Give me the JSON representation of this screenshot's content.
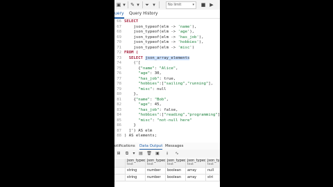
{
  "toolbar": {
    "limit": "No limit"
  },
  "tabs": [
    "uery",
    "Query History"
  ],
  "editor": {
    "lines": [
      {
        "n": "66",
        "c": "SELECT",
        "kind": "kw"
      },
      {
        "n": "67",
        "c": "    json_typeof(elm -> 'name'),"
      },
      {
        "n": "68",
        "c": "    json_typeof(elm -> 'age'),"
      },
      {
        "n": "69",
        "c": "    json_typeof(elm -> 'has_job'),"
      },
      {
        "n": "70",
        "c": "    json_typeof(elm -> 'hobbies'),"
      },
      {
        "n": "71",
        "c": "    json_typeof(elm -> 'misc')"
      },
      {
        "n": "72",
        "c": "FROM (",
        "kind": "kw"
      },
      {
        "n": "73",
        "c": "  SELECT json_array_elements",
        "kind": "kwhl"
      },
      {
        "n": "74",
        "c": "    ('["
      },
      {
        "n": "75",
        "c": "      {\"name\": \"Alice\","
      },
      {
        "n": "76",
        "c": "      \"age\": 30,"
      },
      {
        "n": "77",
        "c": "      \"has_job\": true,"
      },
      {
        "n": "78",
        "c": "      \"hobbies\":[\"sailing\",\"running\"],"
      },
      {
        "n": "79",
        "c": "      \"misc\": null"
      },
      {
        "n": "80",
        "c": "    },"
      },
      {
        "n": "81",
        "c": "    {\"name\": \"Bob\","
      },
      {
        "n": "82",
        "c": "      \"age\": 45,"
      },
      {
        "n": "83",
        "c": "      \"has_job\": false,"
      },
      {
        "n": "84",
        "c": "      \"hobbies\":[\"reading\",\"programming\"],"
      },
      {
        "n": "85",
        "c": "      \"misc\": \"not-null here\""
      },
      {
        "n": "86",
        "c": "    }"
      },
      {
        "n": "87",
        "c": "  ]') AS elm"
      },
      {
        "n": "88",
        "c": ") AS elements;"
      }
    ]
  },
  "results": {
    "tabs": [
      "otifications",
      "Data Output",
      "Messages"
    ],
    "columns": [
      {
        "name": "json_typeof",
        "type": "text"
      },
      {
        "name": "json_typeof",
        "type": "text"
      },
      {
        "name": "json_typeof",
        "type": "text"
      },
      {
        "name": "json_typeof",
        "type": "text"
      },
      {
        "name": "json_ty",
        "type": "text"
      }
    ],
    "rows": [
      [
        "string",
        "number",
        "boolean",
        "array",
        "null"
      ],
      [
        "string",
        "number",
        "boolean",
        "array",
        "stri"
      ]
    ]
  }
}
